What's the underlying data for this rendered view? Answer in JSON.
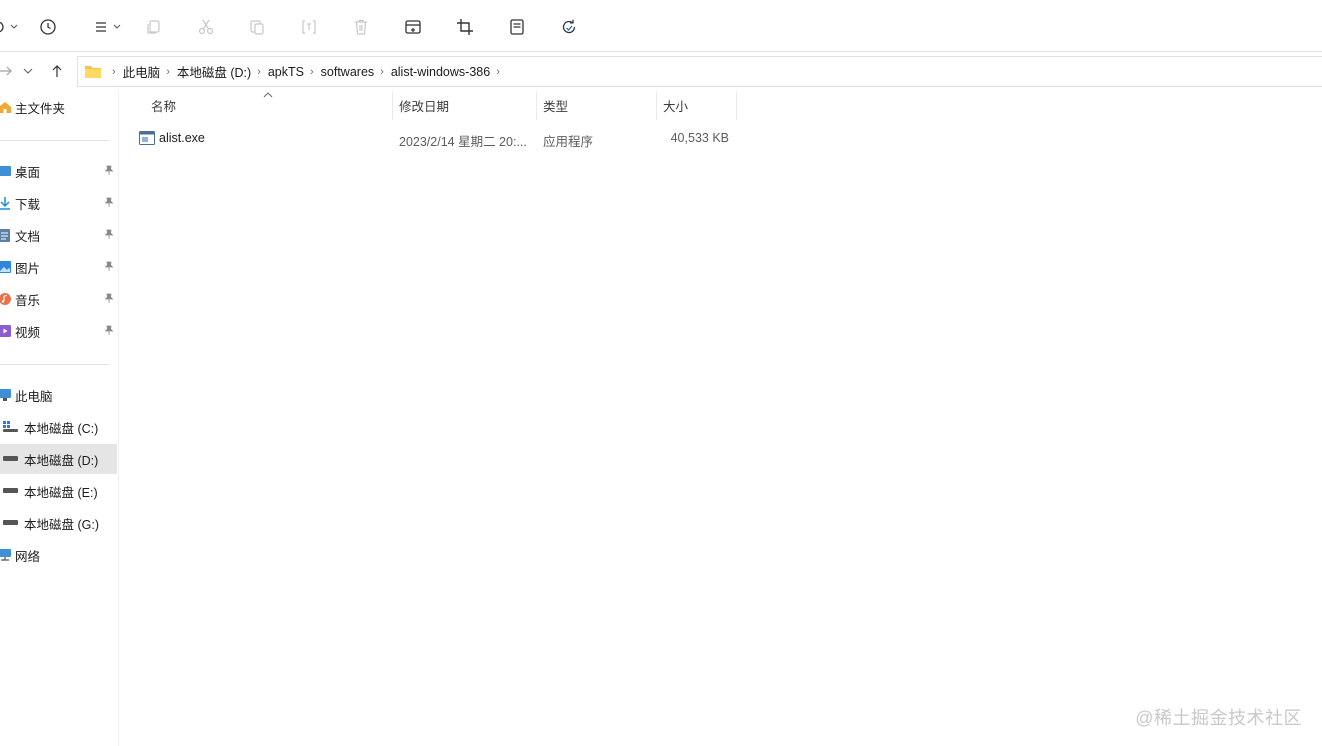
{
  "toolbar": {
    "buttons": [
      {
        "name": "view-options-icon"
      },
      {
        "name": "history-icon"
      },
      {
        "name": "more-options-icon"
      },
      {
        "name": "copy-icon"
      },
      {
        "name": "cut-icon"
      },
      {
        "name": "paste-icon"
      },
      {
        "name": "rename-icon"
      },
      {
        "name": "delete-icon"
      },
      {
        "name": "open-icon"
      },
      {
        "name": "crop-icon"
      },
      {
        "name": "properties-icon"
      },
      {
        "name": "refresh-icon"
      }
    ]
  },
  "address": {
    "crumbs": [
      "此电脑",
      "本地磁盘 (D:)",
      "apkTS",
      "softwares",
      "alist-windows-386"
    ]
  },
  "sidebar": {
    "home": "主文件夹",
    "quick": [
      {
        "label": "桌面",
        "icon": "desktop-icon"
      },
      {
        "label": "下载",
        "icon": "download-icon"
      },
      {
        "label": "文档",
        "icon": "documents-icon"
      },
      {
        "label": "图片",
        "icon": "pictures-icon"
      },
      {
        "label": "音乐",
        "icon": "music-icon"
      },
      {
        "label": "视频",
        "icon": "videos-icon"
      }
    ],
    "this_pc": "此电脑",
    "drives": [
      "本地磁盘 (C:)",
      "本地磁盘 (D:)",
      "本地磁盘 (E:)",
      "本地磁盘 (G:)"
    ],
    "network": "网络"
  },
  "columns": {
    "name": "名称",
    "modified": "修改日期",
    "type": "类型",
    "size": "大小"
  },
  "files": [
    {
      "name": "alist.exe",
      "modified": "2023/2/14 星期二 20:...",
      "type": "应用程序",
      "size": "40,533 KB"
    }
  ],
  "watermark": "@稀土掘金技术社区",
  "colors": {
    "selected": "#e5e5e5",
    "accent": "#0067c0",
    "folder": "#f4c34f"
  }
}
